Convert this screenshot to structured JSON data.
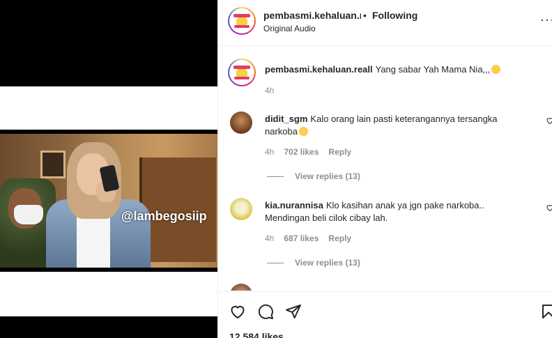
{
  "post": {
    "watermark": "@lambegosiip"
  },
  "header": {
    "username": "pembasmi.kehaluan.reall",
    "dot": "•",
    "follow_status": "Following",
    "audio": "Original Audio",
    "more": "···"
  },
  "caption": {
    "username": "pembasmi.kehaluan.reall",
    "text": "Yang sabar Yah Mama Nia,,,",
    "time": "4h"
  },
  "comments": [
    {
      "username": "didit_sgm",
      "text": "Kalo orang lain pasti keterangannya tersangka narkoba",
      "time": "4h",
      "likes": "702 likes",
      "reply_label": "Reply",
      "view_replies": "View replies (13)"
    },
    {
      "username": "kia.nurannisa",
      "text": "Klo kasihan anak ya jgn pake narkoba.. Mendingan beli cilok cibay lah.",
      "time": "4h",
      "likes": "687 likes",
      "reply_label": "Reply",
      "view_replies": "View replies (13)"
    }
  ],
  "footer": {
    "likes": "12,584 likes"
  },
  "icons": {
    "like": "heart-icon",
    "comment": "comment-icon",
    "share": "share-icon",
    "save": "bookmark-icon",
    "more": "more-icon"
  },
  "colors": {
    "text": "#262626",
    "muted": "#8e8e8e",
    "border": "#efefef"
  }
}
